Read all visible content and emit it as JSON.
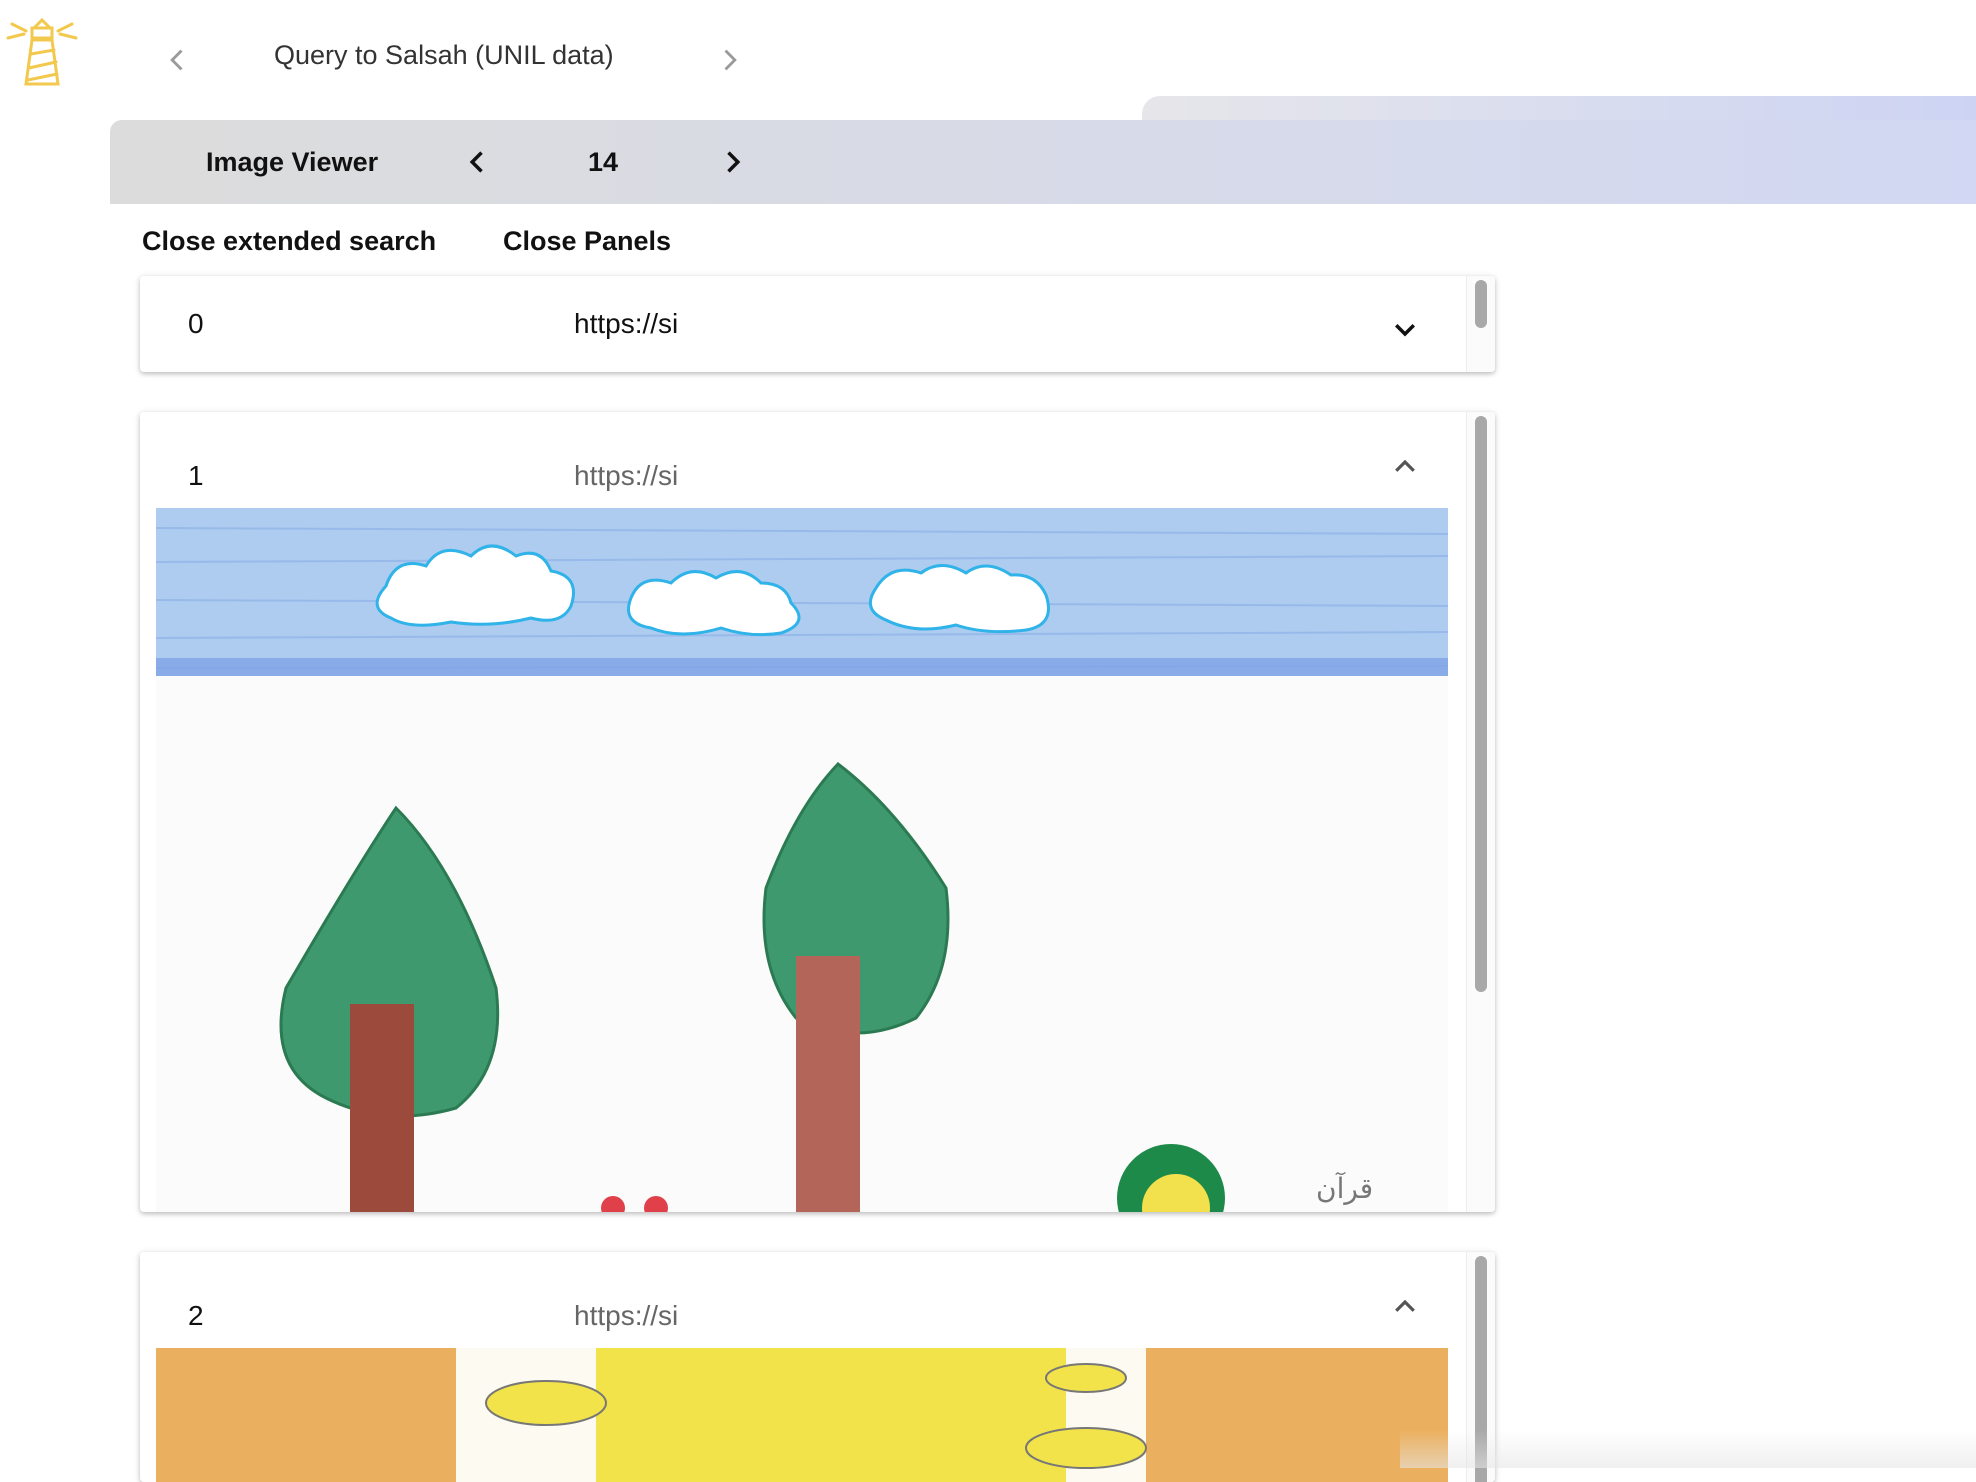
{
  "header": {
    "title": "Query to Salsah (UNIL data)",
    "logo": "lighthouse-icon"
  },
  "viewer": {
    "title": "Image Viewer",
    "count": "14"
  },
  "actions": {
    "close_search": "Close extended search",
    "close_panels": "Close Panels"
  },
  "panels": [
    {
      "index": "0",
      "url": "https://si",
      "expanded": false
    },
    {
      "index": "1",
      "url": "https://si",
      "expanded": true,
      "image": "child drawing: sky with clouds, two trees, flowers, Arabic script"
    },
    {
      "index": "2",
      "url": "https://si",
      "expanded": true,
      "image": "child drawing: yellow sun with orange scribbles"
    }
  ],
  "colors": {
    "accent": "#f2c94c",
    "viewer_bar_start": "#dcdcdc",
    "viewer_bar_end": "#d2d8f3",
    "url_muted": "#666666"
  }
}
